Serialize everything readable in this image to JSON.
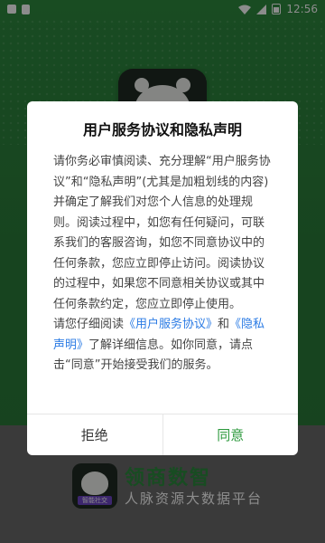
{
  "status_bar": {
    "time": "12:56"
  },
  "background": {
    "brand_name": "领商数智",
    "brand_subtitle": "人脉资源大数据平台",
    "logo_tag": "智能社交"
  },
  "dialog": {
    "title": "用户服务协议和隐私声明",
    "body_intro": "请你务必审慎阅读、充分理解“用户服务协议”和“隐私声明”(尤其是加粗划线的内容)并确定了解我们对您个人信息的处理规则。阅读过程中，如您有任何疑问，可联系我们的客服咨询，如您不同意协议中的任何条款，您应立即停止访问。阅读协议的过程中，如果您不同意相关协议或其中任何条款约定，您应立即停止使用。",
    "read_prefix": "请您仔细阅读",
    "link_service": "《用户服务协议》",
    "and_text": "和",
    "link_privacy": "《隐私声明》",
    "read_suffix": "了解详细信息。如你同意，请点击“同意”开始接受我们的服务。",
    "reject_label": "拒绝",
    "agree_label": "同意"
  },
  "colors": {
    "background_green": "#2b7d3a",
    "link_blue": "#2b7be4",
    "agree_green": "#2e9a3e"
  }
}
